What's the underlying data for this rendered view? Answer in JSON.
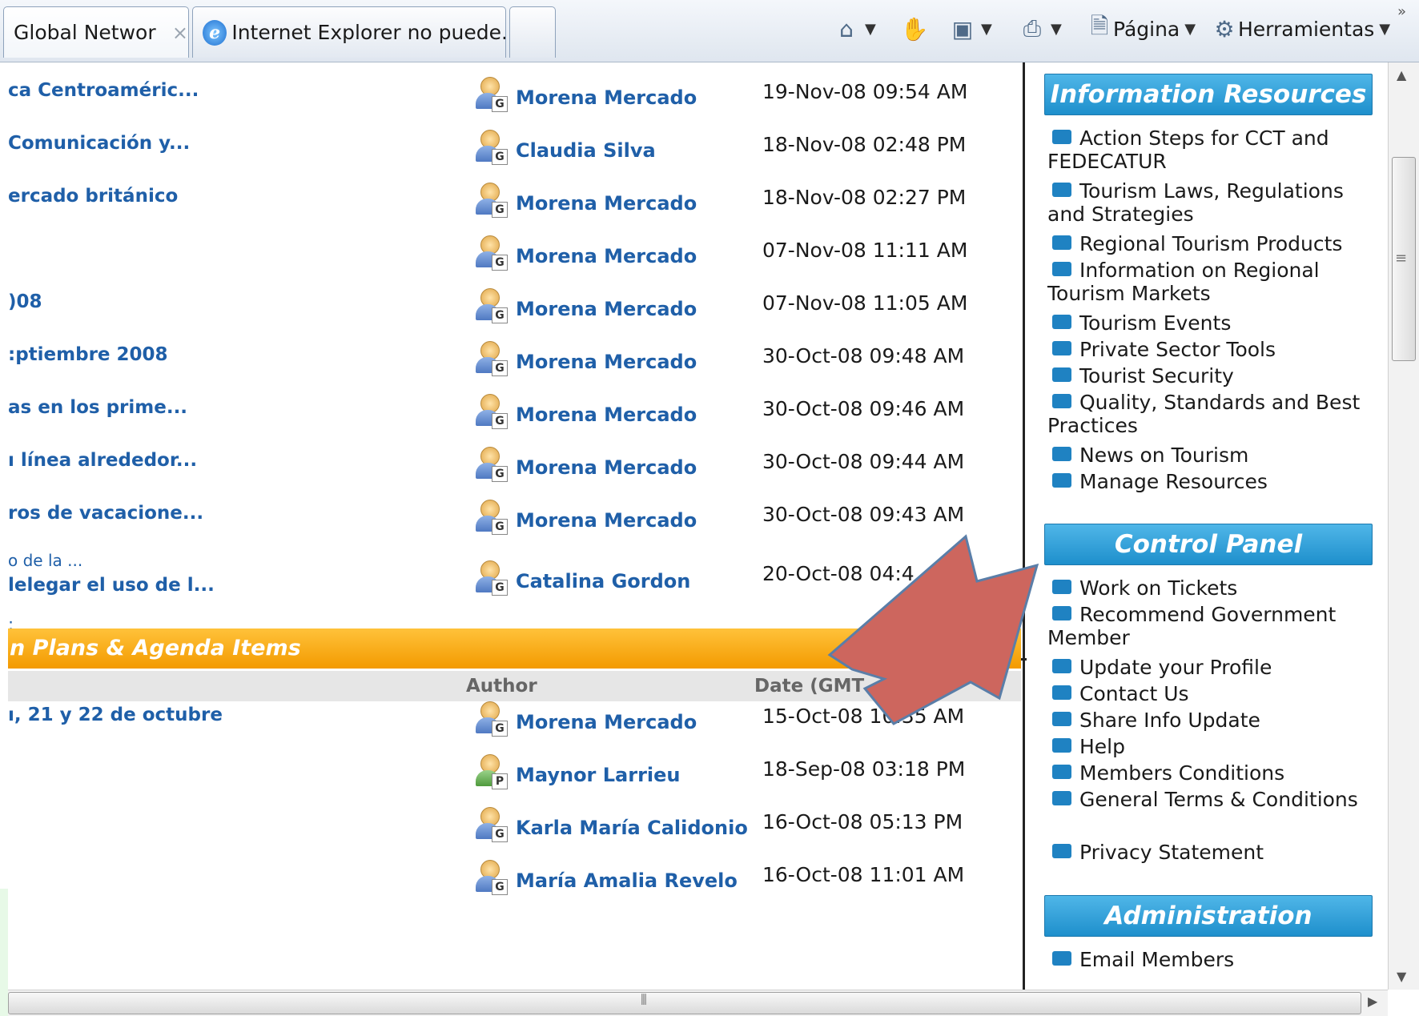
{
  "browser": {
    "tabs": [
      {
        "label": "Global Network S...",
        "close": "×"
      },
      {
        "label": "Internet Explorer no puede..."
      }
    ],
    "commands": {
      "page_label": "Página",
      "tools_label": "Herramientas",
      "overflow": "»"
    }
  },
  "recent_items": [
    {
      "title": "ca Centroaméric...",
      "author": "Morena Mercado",
      "badge": "G",
      "date": "19-Nov-08 09:54 AM"
    },
    {
      "title": "Comunicación y...",
      "author": "Claudia Silva",
      "badge": "G",
      "date": "18-Nov-08 02:48 PM"
    },
    {
      "title": "ercado británico",
      "author": "Morena Mercado",
      "badge": "G",
      "date": "18-Nov-08 02:27 PM"
    },
    {
      "title": "",
      "author": "Morena Mercado",
      "badge": "G",
      "date": "07-Nov-08 11:11 AM"
    },
    {
      "title": ")08",
      "author": "Morena Mercado",
      "badge": "G",
      "date": "07-Nov-08 11:05 AM"
    },
    {
      "title": ":ptiembre 2008",
      "author": "Morena Mercado",
      "badge": "G",
      "date": "30-Oct-08 09:48 AM"
    },
    {
      "title": "as en los prime...",
      "author": "Morena Mercado",
      "badge": "G",
      "date": "30-Oct-08 09:46 AM"
    },
    {
      "title": "ı línea alrededor...",
      "author": "Morena Mercado",
      "badge": "G",
      "date": "30-Oct-08 09:44 AM"
    },
    {
      "title": "ros de vacacione...",
      "author": "Morena Mercado",
      "badge": "G",
      "date": "30-Oct-08 09:43 AM"
    },
    {
      "title": "lelegar el uso de l...",
      "subtitle": "o de la ...",
      "author": "Catalina Gordon",
      "badge": "G",
      "date": "20-Oct-08 04:4"
    }
  ],
  "more_link": ":",
  "plans_section": {
    "title": "n Plans & Agenda Items",
    "col_author": "Author",
    "col_date": "Date (GMT -6)",
    "items": [
      {
        "title": "ı, 21 y 22 de octubre",
        "author": "Morena Mercado",
        "badge": "G",
        "date": "15-Oct-08 10:35 AM"
      },
      {
        "title": "",
        "author": "Maynor Larrieu",
        "badge": "P",
        "date": "18-Sep-08 03:18 PM"
      },
      {
        "title": "",
        "author": "Karla María Calidonio",
        "badge": "G",
        "date": "16-Oct-08 05:13 PM"
      },
      {
        "title": "",
        "author": "María Amalia Revelo",
        "badge": "G",
        "date": "16-Oct-08 11:01 AM"
      }
    ]
  },
  "sidebar": {
    "info_title": "Information Resources",
    "info_items": [
      "Action Steps for CCT and FEDECATUR",
      "Tourism Laws, Regulations and Strategies",
      "Regional Tourism Products",
      "Information on Regional Tourism Markets",
      "Tourism Events",
      "Private Sector Tools",
      "Tourist Security",
      "Quality, Standards and Best Practices",
      "News on Tourism",
      "Manage Resources"
    ],
    "control_title": "Control Panel",
    "control_items": [
      "Work on Tickets",
      "Recommend Government Member",
      "Update your Profile",
      "Contact Us",
      "Share Info Update",
      "Help",
      "Members Conditions",
      "General Terms & Conditions",
      "Privacy Statement"
    ],
    "admin_title": "Administration",
    "admin_items": [
      "Email Members"
    ]
  },
  "colors": {
    "link": "#1f5fa8",
    "section_orange": "#f39a00",
    "sidebar_header": "#1e8fcc",
    "arrow_fill": "#cd665e",
    "arrow_stroke": "#5a7ea8"
  },
  "icons": [
    "home-icon",
    "hand-icon",
    "feed-icon",
    "print-icon",
    "page-icon",
    "gear-icon",
    "ie-logo-icon",
    "user-avatar-icon"
  ]
}
